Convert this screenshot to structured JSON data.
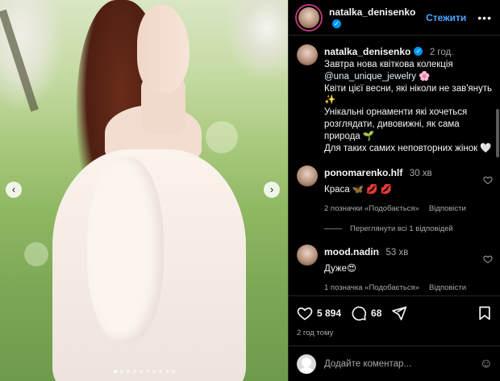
{
  "post": {
    "username": "natalka_denisenko",
    "follow_label": "Стежити",
    "more_label": "•••",
    "image": {
      "prev_label": "‹",
      "next_label": "›",
      "slide_count": 10,
      "active_slide": 1
    }
  },
  "caption": {
    "username": "natalka_denisenko",
    "time": "2 год.",
    "line1": "Завтра нова квіткова колекція",
    "mention": "@una_unique_jewelry",
    "mention_emoji": "🌸",
    "text": "Квіти цієї весни, які ніколи не зав'януть ✨\nУнікальні  орнаменти які хочеться розглядати, дивовижні, як сама природа 🌱\nДля таких самих неповторних жінок 🤍"
  },
  "comments": [
    {
      "username": "ponomarenko.hlf",
      "time": "30 хв",
      "text": "Краса 🦋 💋 💋",
      "likes": "2 позначки «Подобається»",
      "reply_label": "Відповісти",
      "view_replies": "Переглянути всі 1 відповідей"
    },
    {
      "username": "mood.nadin",
      "time": "53 хв",
      "text": "Дуже😍",
      "likes": "1 позначка «Подобається»",
      "reply_label": "Відповісти"
    }
  ],
  "actions": {
    "likes": "5 894",
    "comments": "68",
    "posted": "2 год тому"
  },
  "add_comment": {
    "placeholder": "Додайте коментар...",
    "emoji_icon": "☺"
  },
  "colors": {
    "background": "#000000",
    "link": "#4aa8ff",
    "verified": "#0095f6",
    "muted": "#a8a8a8"
  }
}
